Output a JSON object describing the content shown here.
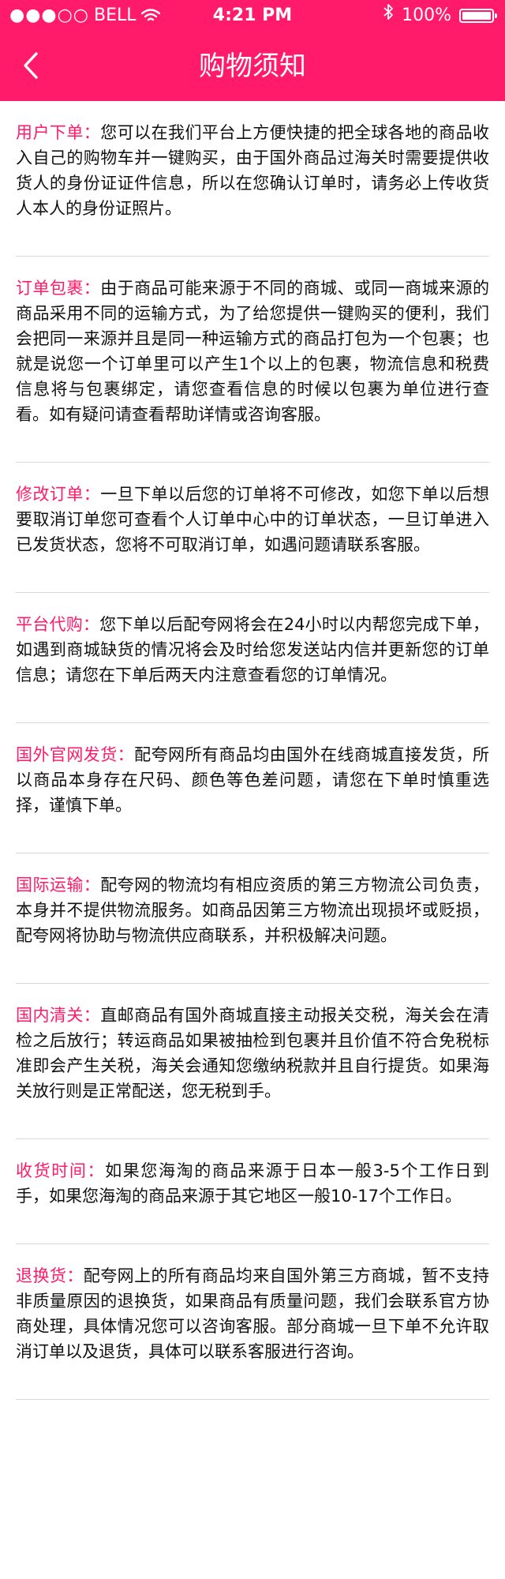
{
  "status_bar": {
    "signal": "●●●○○",
    "carrier": "BELL",
    "time": "4:21 PM",
    "battery": "100%",
    "battery_level": 1.0
  },
  "nav": {
    "title": "购物须知",
    "back_icon": "chevron-left-icon"
  },
  "colors": {
    "accent": "#ff1a6a",
    "text": "#111111",
    "divider": "#d8d8d8"
  },
  "sections": [
    {
      "label": "用户下单：",
      "text": "您可以在我们平台上方便快捷的把全球各地的商品收入自己的购物车并一键购买，由于国外商品过海关时需要提供收货人的身份证证件信息，所以在您确认订单时，请务必上传收货人本人的身份证照片。"
    },
    {
      "label": "订单包裹：",
      "text": "由于商品可能来源于不同的商城、或同一商城来源的商品采用不同的运输方式，为了给您提供一键购买的便利，我们会把同一来源并且是同一种运输方式的商品打包为一个包裹；也就是说您一个订单里可以产生1个以上的包裹，物流信息和税费信息将与包裹绑定，请您查看信息的时候以包裹为单位进行查看。如有疑问请查看帮助详情或咨询客服。"
    },
    {
      "label": "修改订单：",
      "text": "一旦下单以后您的订单将不可修改，如您下单以后想要取消订单您可查看个人订单中心中的订单状态，一旦订单进入已发货状态，您将不可取消订单，如遇问题请联系客服。"
    },
    {
      "label": "平台代购：",
      "text": "您下单以后配夸网将会在24小时以内帮您完成下单，如遇到商城缺货的情况将会及时给您发送站内信并更新您的订单信息；请您在下单后两天内注意查看您的订单情况。"
    },
    {
      "label": "国外官网发货：",
      "text": "配夸网所有商品均由国外在线商城直接发货，所以商品本身存在尺码、颜色等色差问题，请您在下单时慎重选择，谨慎下单。"
    },
    {
      "label": "国际运输：",
      "text": "配夸网的物流均有相应资质的第三方物流公司负责，本身并不提供物流服务。如商品因第三方物流出现损坏或贬损，配夸网将协助与物流供应商联系，并积极解决问题。"
    },
    {
      "label": "国内清关：",
      "text": "直邮商品有国外商城直接主动报关交税，海关会在清检之后放行；转运商品如果被抽检到包裹并且价值不符合免税标准即会产生关税，海关会通知您缴纳税款并且自行提货。如果海关放行则是正常配送，您无税到手。"
    },
    {
      "label": "收货时间：",
      "text": "如果您海淘的商品来源于日本一般3-5个工作日到手，如果您海淘的商品来源于其它地区一般10-17个工作日。"
    },
    {
      "label": "退换货：",
      "text": "配夸网上的所有商品均来自国外第三方商城，暂不支持非质量原因的退换货，如果商品有质量问题，我们会联系官方协商处理，具体情况您可以咨询客服。部分商城一旦下单不允许取消订单以及退货，具体可以联系客服进行咨询。"
    }
  ]
}
